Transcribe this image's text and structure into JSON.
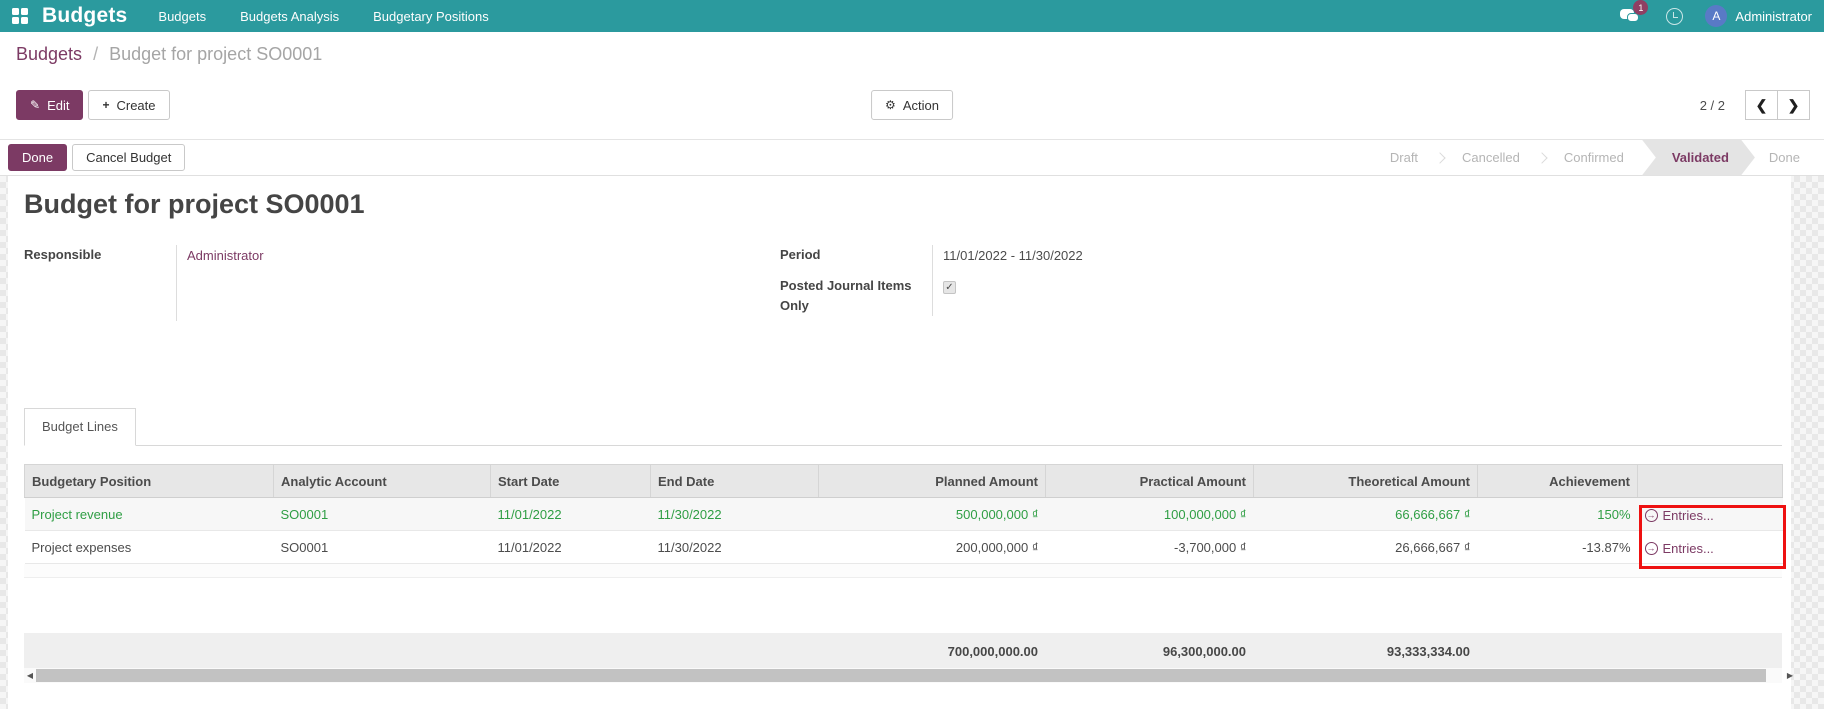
{
  "colors": {
    "navbar_bg": "#2b9a9e",
    "primary_purple": "#7c3a64",
    "success_green": "#2f9e44",
    "annotation_red": "#ee1111",
    "avatar_blue": "#597ac6",
    "badge_magenta": "#8f3f63"
  },
  "navbar": {
    "brand": "Budgets",
    "menu": [
      {
        "label": "Budgets"
      },
      {
        "label": "Budgets Analysis"
      },
      {
        "label": "Budgetary Positions"
      }
    ],
    "messages_badge": "1",
    "user": {
      "initial": "A",
      "name": "Administrator"
    }
  },
  "breadcrumb": {
    "parent": "Budgets",
    "separator": "/",
    "current": "Budget for project SO0001"
  },
  "control_panel": {
    "edit_label": "Edit",
    "edit_icon": "✎",
    "create_label": "Create",
    "create_icon": "+",
    "action_label": "Action",
    "action_icon": "⚙",
    "pager_value": "2 / 2",
    "prev_icon": "❮",
    "next_icon": "❯"
  },
  "statusbar": {
    "done_button": "Done",
    "cancel_button": "Cancel Budget",
    "steps": [
      {
        "label": "Draft",
        "active": false
      },
      {
        "label": "Cancelled",
        "active": false
      },
      {
        "label": "Confirmed",
        "active": false
      },
      {
        "label": "Validated",
        "active": true
      },
      {
        "label": "Done",
        "active": false
      }
    ]
  },
  "form": {
    "title": "Budget for project SO0001",
    "fields": {
      "responsible_label": "Responsible",
      "responsible_value": "Administrator",
      "period_label": "Period",
      "period_value": "11/01/2022 - 11/30/2022",
      "posted_label": "Posted Journal Items Only",
      "posted_checked": true,
      "check_glyph": "✓"
    },
    "tab_label": "Budget Lines"
  },
  "table": {
    "headers": [
      "Budgetary Position",
      "Analytic Account",
      "Start Date",
      "End Date",
      "Planned Amount",
      "Practical Amount",
      "Theoretical Amount",
      "Achievement",
      ""
    ],
    "entries_icon": "→",
    "rows": [
      {
        "budgetary_position": "Project revenue",
        "analytic_account": "SO0001",
        "start_date": "11/01/2022",
        "end_date": "11/30/2022",
        "planned_amount": "500,000,000 ₫",
        "practical_amount": "100,000,000 ₫",
        "theoretical_amount": "66,666,667 ₫",
        "achievement": "150%",
        "entries_label": "Entries..."
      },
      {
        "budgetary_position": "Project expenses",
        "analytic_account": "SO0001",
        "start_date": "11/01/2022",
        "end_date": "11/30/2022",
        "planned_amount": "200,000,000 ₫",
        "practical_amount": "-3,700,000 ₫",
        "theoretical_amount": "26,666,667 ₫",
        "achievement": "-13.87%",
        "entries_label": "Entries..."
      }
    ],
    "totals": {
      "planned": "700,000,000.00",
      "practical": "96,300,000.00",
      "theoretical": "93,333,334.00"
    },
    "scroll_left_icon": "◀",
    "scroll_right_icon": "▶"
  }
}
